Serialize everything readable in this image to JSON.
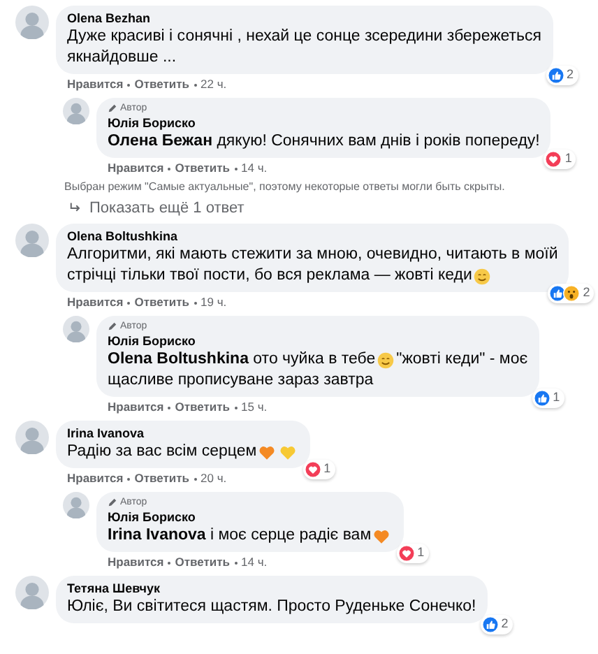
{
  "threads": [
    {
      "comment": {
        "author": "Olena Bezhan",
        "lines": [
          [
            {
              "kind": "text",
              "text": "Дуже красиві і сонячні , нехай це сонце зсередини збережеться"
            }
          ],
          [
            {
              "kind": "text",
              "text": "якнайдовше ..."
            }
          ]
        ],
        "reactions": [
          {
            "kind": "like"
          }
        ],
        "reaction_count": "2",
        "like": "Нравится",
        "reply": "Ответить",
        "time": "22 ч."
      },
      "replies": [
        {
          "badge": "Автор",
          "author": "Юлія Бориско",
          "lines": [
            [
              {
                "kind": "text",
                "text": "**Олена Бежан** дякую! Сонячних вам днів і років попереду!"
              }
            ]
          ],
          "reactions": [
            {
              "kind": "love"
            }
          ],
          "reaction_count": "1",
          "like": "Нравится",
          "reply": "Ответить",
          "time": "14 ч."
        }
      ],
      "notice": "Выбран режим \"Самые актуальные\", поэтому некоторые ответы могли быть скрыты.",
      "more": "Показать ещё 1 ответ"
    },
    {
      "comment": {
        "author": "Olena Boltushkina",
        "lines": [
          [
            {
              "kind": "text",
              "text": "Алгоритми, які мають стежити за мною, очевидно, читають в моїй"
            }
          ],
          [
            {
              "kind": "text",
              "text": "стрічці тільки твої пости, бо вся реклама — жовті кеди"
            },
            {
              "kind": "smiley"
            }
          ]
        ],
        "reactions": [
          {
            "kind": "like"
          },
          {
            "kind": "wow"
          }
        ],
        "reaction_count": "2",
        "like": "Нравится",
        "reply": "Ответить",
        "time": "19 ч."
      },
      "replies": [
        {
          "badge": "Автор",
          "author": "Юлія Бориско",
          "lines": [
            [
              {
                "kind": "text",
                "text": "**Olena Boltushkina** ото чуйка в тебе"
              },
              {
                "kind": "smiley"
              },
              {
                "kind": "text",
                "text": "\"жовті кеди\" - моє"
              }
            ],
            [
              {
                "kind": "text",
                "text": "щасливе прописуване зараз завтра"
              }
            ]
          ],
          "reactions": [
            {
              "kind": "like"
            }
          ],
          "reaction_count": "1",
          "like": "Нравится",
          "reply": "Ответить",
          "time": "15 ч."
        }
      ]
    },
    {
      "comment": {
        "author": "Irina Ivanova",
        "lines": [
          [
            {
              "kind": "text",
              "text": "Радію за вас всім серцем"
            },
            {
              "kind": "orange_heart"
            },
            {
              "kind": "yellow_heart"
            }
          ]
        ],
        "reactions": [
          {
            "kind": "love"
          }
        ],
        "reaction_count": "1",
        "like": "Нравится",
        "reply": "Ответить",
        "time": "20 ч."
      },
      "replies": [
        {
          "badge": "Автор",
          "author": "Юлія Бориско",
          "lines": [
            [
              {
                "kind": "text",
                "text": "**Irina Ivanova** і моє серце радіє вам"
              },
              {
                "kind": "orange_heart"
              }
            ]
          ],
          "reactions": [
            {
              "kind": "love"
            }
          ],
          "reaction_count": "1",
          "like": "Нравится",
          "reply": "Ответить",
          "time": "14 ч."
        }
      ]
    },
    {
      "comment": {
        "author": "Тетяна Шевчук",
        "lines": [
          [
            {
              "kind": "text",
              "text": "Юліє, Ви світитеся щастям. Просто Руденьке Сонечко!"
            }
          ]
        ],
        "reactions": [
          {
            "kind": "like"
          }
        ],
        "reaction_count": "2"
      }
    }
  ]
}
